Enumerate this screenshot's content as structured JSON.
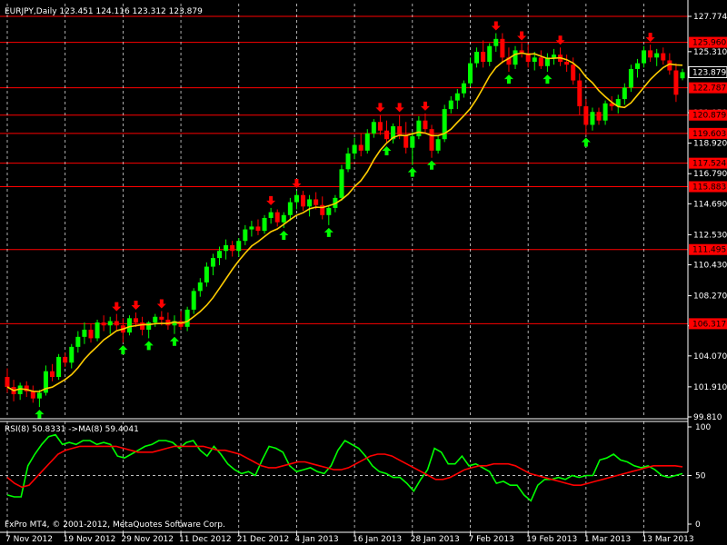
{
  "main": {
    "header": "EURJPY,Daily  123.451 124.116 123.312 123.879",
    "price_ticks": [
      "127.774",
      "125.310",
      "123.879",
      "121.050",
      "118.920",
      "116.790",
      "114.690",
      "112.530",
      "110.430",
      "108.270",
      "106.170",
      "104.070",
      "101.910",
      "99.810"
    ],
    "current_price": "123.879",
    "level_tags": [
      "125.960",
      "122.787",
      "120.879",
      "119.603",
      "117.524",
      "115.883",
      "111.495",
      "106.317"
    ]
  },
  "rsi": {
    "label": "RSI(8) 50.8331  ->MA(8) 59.4041",
    "ticks": [
      "100",
      "50",
      "0"
    ]
  },
  "dates": [
    "7 Nov 2012",
    "19 Nov 2012",
    "29 Nov 2012",
    "11 Dec 2012",
    "21 Dec 2012",
    "4 Jan 2013",
    "16 Jan 2013",
    "28 Jan 2013",
    "7 Feb 2013",
    "19 Feb 2013",
    "1 Mar 2013",
    "13 Mar 2013"
  ],
  "copyright": "FxPro MT4, © 2001-2012, MetaQuotes Software Corp.",
  "colors": {
    "background": "#000000",
    "bull_candle": "#00ff00",
    "bear_candle": "#ff0000",
    "ma_line": "#ffcc00",
    "level_line": "#ff0000",
    "rsi_line": "#00ff00",
    "rsi_ma_line": "#ff0000",
    "grid": "#ffffff",
    "up_arrow": "#00ff00",
    "down_arrow": "#ff0000"
  },
  "chart_data": {
    "type": "line",
    "title": "EURJPY,Daily",
    "ohlc_last": {
      "open": 123.451,
      "high": 124.116,
      "low": 123.312,
      "close": 123.879
    },
    "x": [
      "7 Nov 2012",
      "19 Nov 2012",
      "29 Nov 2012",
      "11 Dec 2012",
      "21 Dec 2012",
      "4 Jan 2013",
      "16 Jan 2013",
      "28 Jan 2013",
      "7 Feb 2013",
      "19 Feb 2013",
      "1 Mar 2013",
      "13 Mar 2013"
    ],
    "ylim": [
      99.81,
      127.774
    ],
    "horizontal_levels": [
      127.774,
      125.96,
      122.787,
      120.879,
      119.603,
      117.524,
      115.883,
      111.495,
      106.317
    ],
    "candles": [
      [
        102.6,
        103.2,
        101.5,
        101.9
      ],
      [
        101.9,
        102.4,
        100.9,
        101.4
      ],
      [
        101.4,
        102.2,
        101.0,
        102.0
      ],
      [
        102.0,
        102.3,
        101.2,
        101.6
      ],
      [
        101.6,
        102.0,
        100.8,
        101.1
      ],
      [
        101.1,
        101.7,
        100.5,
        101.5
      ],
      [
        101.5,
        103.4,
        101.3,
        103.0
      ],
      [
        103.0,
        103.5,
        102.3,
        102.6
      ],
      [
        102.6,
        104.2,
        102.4,
        104.0
      ],
      [
        104.0,
        104.3,
        103.3,
        103.6
      ],
      [
        103.6,
        104.9,
        103.2,
        104.7
      ],
      [
        104.7,
        105.8,
        104.3,
        105.4
      ],
      [
        105.4,
        106.4,
        104.9,
        105.9
      ],
      [
        105.9,
        106.3,
        105.0,
        105.3
      ],
      [
        105.3,
        106.6,
        105.1,
        106.4
      ],
      [
        106.4,
        106.9,
        105.8,
        106.2
      ],
      [
        106.2,
        106.8,
        105.6,
        106.5
      ],
      [
        106.5,
        107.0,
        105.9,
        106.2
      ],
      [
        106.2,
        106.7,
        105.0,
        105.7
      ],
      [
        105.7,
        106.9,
        105.5,
        106.7
      ],
      [
        106.7,
        107.1,
        106.1,
        106.4
      ],
      [
        106.4,
        106.8,
        105.5,
        105.9
      ],
      [
        105.9,
        106.5,
        105.3,
        106.4
      ],
      [
        106.4,
        107.0,
        106.1,
        106.8
      ],
      [
        106.8,
        107.2,
        106.2,
        106.6
      ],
      [
        106.6,
        107.1,
        105.9,
        106.2
      ],
      [
        106.2,
        106.9,
        105.6,
        106.5
      ],
      [
        106.5,
        107.2,
        105.9,
        106.1
      ],
      [
        106.1,
        107.5,
        105.8,
        107.3
      ],
      [
        107.3,
        108.8,
        107.0,
        108.6
      ],
      [
        108.6,
        109.5,
        108.2,
        109.2
      ],
      [
        109.2,
        110.6,
        108.9,
        110.3
      ],
      [
        110.3,
        111.2,
        109.7,
        110.9
      ],
      [
        110.9,
        111.7,
        110.4,
        111.4
      ],
      [
        111.4,
        112.2,
        110.8,
        111.8
      ],
      [
        111.8,
        112.1,
        111.0,
        111.4
      ],
      [
        111.4,
        112.3,
        111.0,
        112.1
      ],
      [
        112.1,
        113.2,
        111.8,
        112.9
      ],
      [
        112.9,
        113.5,
        112.4,
        113.1
      ],
      [
        113.1,
        113.6,
        112.5,
        112.8
      ],
      [
        112.8,
        113.9,
        112.6,
        113.7
      ],
      [
        113.7,
        114.4,
        113.3,
        114.1
      ],
      [
        114.1,
        114.3,
        113.1,
        113.4
      ],
      [
        113.4,
        114.1,
        113.0,
        113.9
      ],
      [
        113.9,
        115.1,
        113.5,
        114.8
      ],
      [
        114.8,
        115.6,
        114.3,
        115.3
      ],
      [
        115.3,
        115.6,
        114.2,
        114.5
      ],
      [
        114.5,
        115.3,
        113.8,
        115.0
      ],
      [
        115.0,
        115.5,
        114.3,
        114.6
      ],
      [
        114.6,
        115.2,
        113.6,
        113.9
      ],
      [
        113.9,
        114.6,
        113.2,
        114.4
      ],
      [
        114.4,
        115.3,
        114.1,
        115.1
      ],
      [
        115.1,
        117.4,
        114.9,
        117.1
      ],
      [
        117.1,
        118.6,
        116.9,
        118.2
      ],
      [
        118.2,
        119.3,
        117.8,
        118.8
      ],
      [
        118.8,
        119.6,
        118.0,
        118.4
      ],
      [
        118.4,
        119.9,
        118.2,
        119.6
      ],
      [
        119.6,
        120.6,
        119.3,
        120.4
      ],
      [
        120.4,
        120.9,
        119.5,
        119.8
      ],
      [
        119.8,
        120.5,
        118.9,
        119.2
      ],
      [
        119.2,
        120.3,
        118.9,
        120.1
      ],
      [
        120.1,
        120.9,
        119.2,
        119.5
      ],
      [
        119.5,
        120.4,
        118.2,
        118.6
      ],
      [
        118.6,
        119.7,
        117.4,
        119.4
      ],
      [
        119.4,
        120.8,
        119.2,
        120.5
      ],
      [
        120.5,
        121.0,
        119.6,
        119.9
      ],
      [
        119.9,
        120.2,
        117.9,
        118.4
      ],
      [
        118.4,
        119.4,
        118.2,
        119.2
      ],
      [
        119.2,
        121.6,
        119.0,
        121.3
      ],
      [
        121.3,
        122.2,
        121.0,
        121.9
      ],
      [
        121.9,
        122.7,
        121.3,
        122.4
      ],
      [
        122.4,
        123.3,
        122.1,
        123.1
      ],
      [
        123.1,
        124.9,
        122.9,
        124.5
      ],
      [
        124.5,
        125.6,
        124.2,
        125.3
      ],
      [
        125.3,
        126.1,
        124.2,
        124.6
      ],
      [
        124.6,
        125.9,
        124.3,
        125.7
      ],
      [
        125.7,
        126.6,
        125.3,
        126.2
      ],
      [
        126.2,
        126.6,
        124.5,
        124.9
      ],
      [
        124.9,
        125.6,
        123.9,
        124.4
      ],
      [
        124.4,
        125.7,
        124.1,
        125.4
      ],
      [
        125.4,
        125.9,
        124.9,
        125.2
      ],
      [
        125.2,
        125.8,
        124.2,
        124.6
      ],
      [
        124.6,
        125.3,
        124.0,
        124.9
      ],
      [
        124.9,
        125.4,
        124.1,
        124.3
      ],
      [
        124.3,
        125.2,
        123.9,
        124.9
      ],
      [
        124.9,
        125.5,
        124.4,
        125.1
      ],
      [
        125.1,
        125.6,
        124.3,
        124.6
      ],
      [
        124.6,
        125.1,
        123.9,
        124.4
      ],
      [
        124.4,
        124.9,
        123.0,
        123.3
      ],
      [
        123.3,
        123.8,
        120.9,
        121.5
      ],
      [
        121.5,
        122.0,
        119.5,
        120.2
      ],
      [
        120.2,
        121.4,
        119.8,
        121.1
      ],
      [
        121.1,
        121.4,
        120.2,
        120.5
      ],
      [
        120.5,
        121.9,
        120.2,
        121.7
      ],
      [
        121.7,
        122.2,
        121.2,
        121.5
      ],
      [
        121.5,
        122.3,
        121.0,
        122.0
      ],
      [
        122.0,
        123.1,
        121.6,
        122.8
      ],
      [
        122.8,
        124.4,
        122.5,
        124.1
      ],
      [
        124.1,
        124.8,
        123.5,
        124.5
      ],
      [
        124.5,
        125.7,
        124.2,
        125.4
      ],
      [
        125.4,
        125.8,
        124.6,
        124.9
      ],
      [
        124.9,
        125.5,
        124.3,
        125.2
      ],
      [
        125.2,
        125.6,
        124.4,
        124.7
      ],
      [
        124.7,
        125.2,
        123.7,
        124.0
      ],
      [
        124.0,
        124.5,
        121.8,
        122.3
      ],
      [
        123.451,
        124.116,
        123.312,
        123.879
      ]
    ],
    "series": [
      {
        "name": "RSI(8)",
        "ylim": [
          0,
          100
        ],
        "last": 50.8331,
        "values": [
          30,
          28,
          28,
          60,
          72,
          82,
          90,
          92,
          82,
          84,
          82,
          86,
          86,
          82,
          84,
          82,
          70,
          68,
          72,
          76,
          80,
          82,
          86,
          86,
          84,
          78,
          84,
          86,
          76,
          70,
          80,
          72,
          62,
          56,
          52,
          54,
          50,
          66,
          80,
          78,
          74,
          60,
          54,
          56,
          58,
          54,
          52,
          60,
          76,
          86,
          82,
          78,
          70,
          60,
          54,
          52,
          48,
          48,
          42,
          34,
          46,
          56,
          78,
          74,
          62,
          62,
          70,
          60,
          62,
          58,
          54,
          42,
          44,
          40,
          40,
          30,
          24,
          40,
          46,
          46,
          48,
          46,
          50,
          48,
          50,
          50,
          66,
          68,
          72,
          66,
          64,
          60,
          58,
          60,
          56,
          50,
          48,
          50,
          52
        ]
      },
      {
        "name": "MA(8)",
        "ylim": [
          0,
          100
        ],
        "last": 59.4041,
        "values": [
          48,
          42,
          38,
          40,
          48,
          56,
          64,
          72,
          76,
          78,
          80,
          80,
          80,
          80,
          80,
          80,
          78,
          76,
          74,
          74,
          74,
          76,
          78,
          80,
          80,
          80,
          80,
          80,
          78,
          76,
          76,
          74,
          72,
          68,
          64,
          60,
          58,
          58,
          60,
          62,
          64,
          64,
          62,
          60,
          58,
          56,
          56,
          58,
          62,
          66,
          70,
          72,
          72,
          70,
          66,
          62,
          58,
          54,
          50,
          46,
          46,
          48,
          52,
          56,
          58,
          60,
          60,
          62,
          62,
          62,
          60,
          56,
          52,
          50,
          48,
          46,
          44,
          42,
          40,
          40,
          42,
          44,
          46,
          48,
          50,
          52,
          54,
          56,
          58,
          60,
          60,
          60,
          60,
          59
        ]
      }
    ],
    "grid": true,
    "legend": "none"
  }
}
